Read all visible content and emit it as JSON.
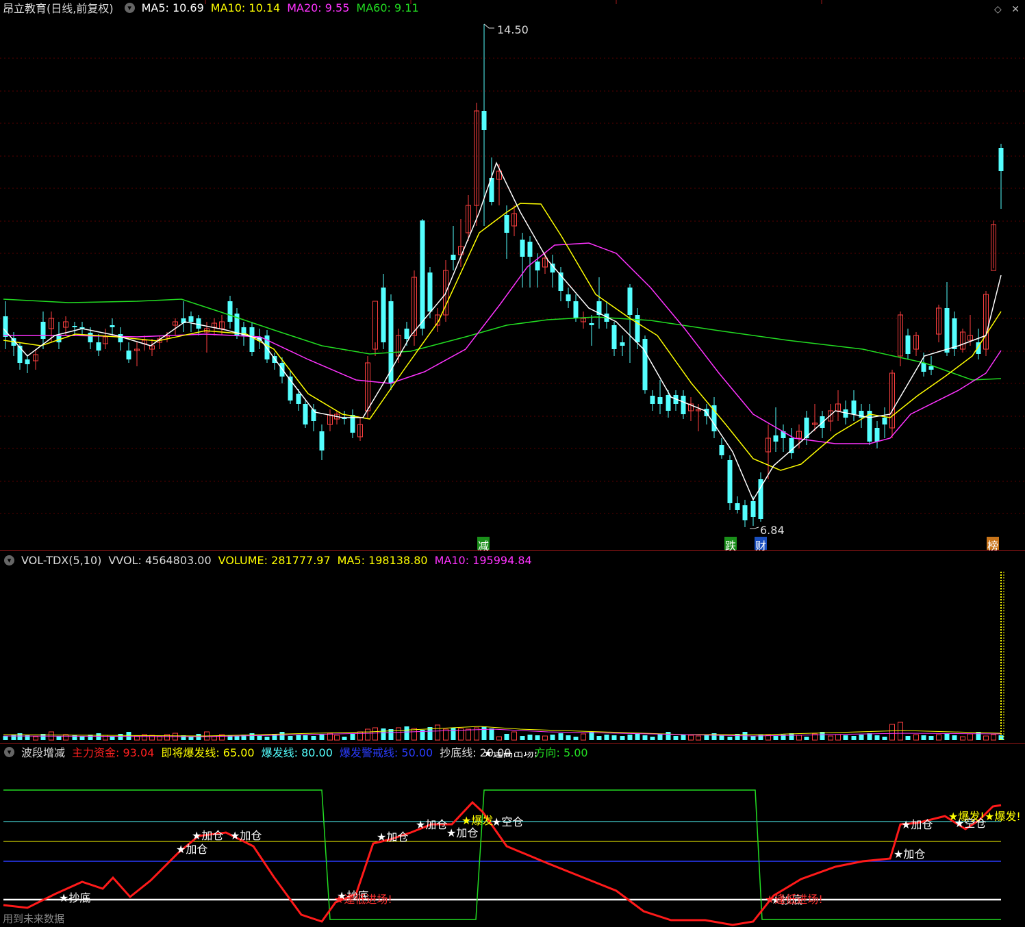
{
  "main_header": {
    "title": "昂立教育(日线,前复权)",
    "ma5": "MA5: 10.69",
    "ma10": "MA10: 10.14",
    "ma20": "MA20: 9.55",
    "ma60": "MA60: 9.11"
  },
  "main_chart": {
    "high_label": "14.50",
    "low_label": "6.84",
    "events": [
      {
        "label": "减",
        "color": "#1a8f1a"
      },
      {
        "label": "跌",
        "color": "#1a8f1a"
      },
      {
        "label": "财",
        "color": "#1a4fbf"
      },
      {
        "label": "榜",
        "color": "#c8741a"
      }
    ]
  },
  "vol_header": {
    "name": "VOL-TDX(5,10)",
    "vvol": "VVOL: 4564803.00",
    "volume": "VOLUME: 281777.97",
    "ma5": "MA5: 198138.80",
    "ma10": "MA10: 195994.84"
  },
  "ind_header": {
    "name": "波段增减",
    "main_fund": "主力资金: 93.04",
    "about_burst": "即将爆发线: 65.00",
    "burst": "爆发线: 80.00",
    "burst_warn": "爆发警戒线: 50.00",
    "bottom": "抄底线: 20.00",
    "direction": "方向: 5.00"
  },
  "ind_top_label": "★逢高出场!",
  "signals": [
    {
      "text": "★抄底"
    },
    {
      "text": "★加仓"
    },
    {
      "text": "★加仓"
    },
    {
      "text": "★加仓"
    },
    {
      "text": "★抄底"
    },
    {
      "text": "★逢低进场!"
    },
    {
      "text": "★加仓"
    },
    {
      "text": "★加仓"
    },
    {
      "text": "★加仓"
    },
    {
      "text": "★爆发"
    },
    {
      "text": "★空仓"
    },
    {
      "text": "★抄底"
    },
    {
      "text": "★逢低进场!"
    },
    {
      "text": "★加仓"
    },
    {
      "text": "★加仓"
    },
    {
      "text": "★爆发!"
    },
    {
      "text": "★空仓"
    },
    {
      "text": "★爆发!"
    }
  ],
  "footer": "用到未来数据",
  "colors": {
    "up": "#ff4040",
    "down": "#54ffff",
    "ma5": "#ffffff",
    "ma10": "#ffff00",
    "ma20": "#ff33ff",
    "ma60": "#22dd22",
    "grid": "#5a0000"
  }
}
